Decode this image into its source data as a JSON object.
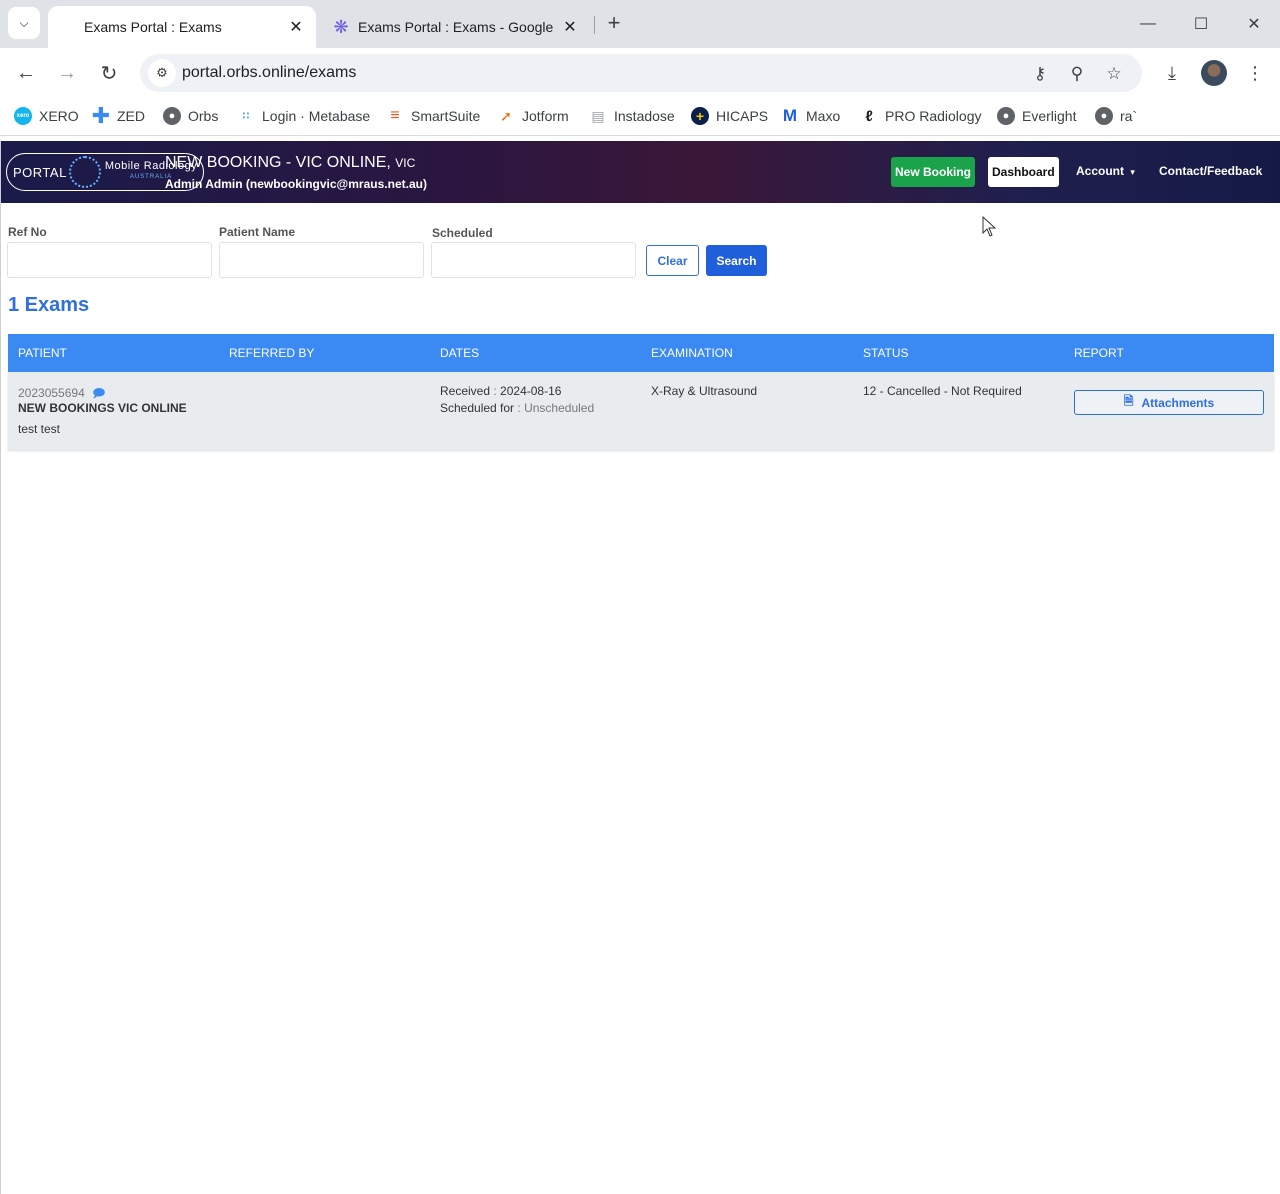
{
  "browser": {
    "tabs": [
      {
        "title": "Exams Portal : Exams",
        "active": true
      },
      {
        "title": "Exams Portal : Exams - Google (",
        "active": false
      }
    ],
    "url": "portal.orbs.online/exams",
    "bookmarks": [
      {
        "label": "XERO",
        "icon": "xero-icon",
        "color": "#13b5ea"
      },
      {
        "label": "ZED",
        "icon": "plus-cross-icon",
        "color": "#3b8af4"
      },
      {
        "label": "Orbs",
        "icon": "globe-icon",
        "color": "#5f6368"
      },
      {
        "label": "Login · Metabase",
        "icon": "metabase-icon",
        "color": "#509ee3"
      },
      {
        "label": "SmartSuite",
        "icon": "smartsuite-icon",
        "color": "#f05a28"
      },
      {
        "label": "Jotform",
        "icon": "jotform-icon",
        "color": "#ff6100"
      },
      {
        "label": "Instadose",
        "icon": "document-icon",
        "color": "#9aa0a6"
      },
      {
        "label": "HICAPS",
        "icon": "hicaps-icon",
        "color": "#0b1f4d"
      },
      {
        "label": "Maxo",
        "icon": "maxo-icon",
        "color": "#1f5fd9"
      },
      {
        "label": "PRO Radiology",
        "icon": "pro-radiology-icon",
        "color": "#202124"
      },
      {
        "label": "Everlight",
        "icon": "globe-icon",
        "color": "#5f6368"
      },
      {
        "label": "ra`",
        "icon": "globe-icon",
        "color": "#5f6368"
      }
    ]
  },
  "header": {
    "logo_portal": "PORTAL",
    "logo_brand": "Mobile Radiology",
    "logo_sub": "AUSTRALIA",
    "title": "NEW BOOKING - VIC ONLINE,",
    "state": "VIC",
    "user": "Admin Admin (newbookingvic@mraus.net.au)",
    "new_booking": "New Booking",
    "dashboard": "Dashboard",
    "account": "Account",
    "account_caret": "▾",
    "contact": "Contact/Feedback"
  },
  "filters": {
    "ref_no_label": "Ref No",
    "ref_no_value": "",
    "patient_name_label": "Patient Name",
    "patient_name_value": "",
    "scheduled_label": "Scheduled",
    "scheduled_value": "",
    "clear": "Clear",
    "search": "Search"
  },
  "count_heading": "1 Exams",
  "table": {
    "columns": [
      "PATIENT",
      "REFERRED BY",
      "DATES",
      "EXAMINATION",
      "STATUS",
      "REPORT"
    ],
    "rows": [
      {
        "patient_id": "2023055694",
        "patient_name": "NEW BOOKINGS VIC ONLINE",
        "patient_note": "test test",
        "referred_by": "",
        "received_label": "Received",
        "received_sep": " : ",
        "received_date": "2024-08-16",
        "scheduled_label": "Scheduled for",
        "scheduled_sep": " : ",
        "scheduled_value": "Unscheduled",
        "examination": "X-Ray & Ultrasound",
        "status": "12 - Cancelled - Not Required",
        "report_button": "Attachments"
      }
    ]
  },
  "colors": {
    "accent": "#2f6fe0",
    "table_header": "#3b8af4",
    "new_booking_green": "#1aa34a"
  }
}
